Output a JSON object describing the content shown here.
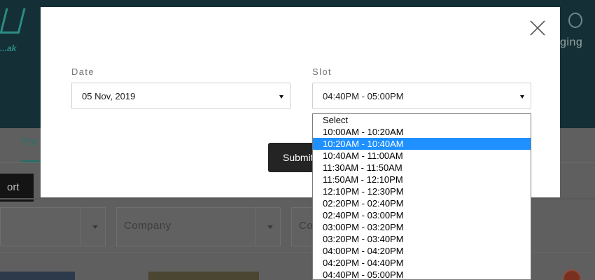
{
  "background": {
    "logo_text": "...ak",
    "messaging_text": "ging",
    "tab_label": "Par",
    "export_label": "ort",
    "filters": [
      "",
      "Company",
      "Co"
    ]
  },
  "modal": {
    "date_label": "Date",
    "slot_label": "Slot",
    "date_value": "05 Nov, 2019",
    "slot_value": "04:40PM - 05:00PM",
    "submit_label": "Submit",
    "close_icon": "close-icon"
  },
  "slot_dropdown": {
    "highlighted_option": "10:20AM - 10:40AM",
    "options": [
      "Select",
      "10:00AM - 10:20AM",
      "10:20AM - 10:40AM",
      "10:40AM - 11:00AM",
      "11:30AM - 11:50AM",
      "11:50AM - 12:10PM",
      "12:10PM - 12:30PM",
      "02:20PM - 02:40PM",
      "02:40PM - 03:00PM",
      "03:00PM - 03:20PM",
      "03:20PM - 03:40PM",
      "04:00PM - 04:20PM",
      "04:20PM - 04:40PM",
      "04:40PM - 05:00PM"
    ]
  },
  "colors": {
    "overlay": "#5f5f5f",
    "header": "#143036",
    "accent": "#2a6d66",
    "highlight": "#1e90ff",
    "submit_bg": "#242424"
  }
}
